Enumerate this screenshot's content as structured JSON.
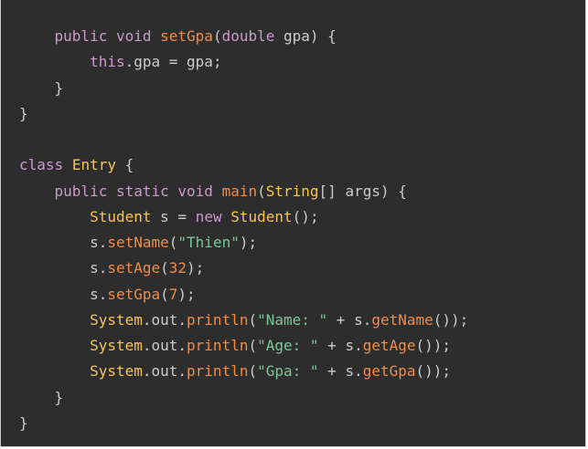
{
  "editor": {
    "theme": {
      "background": "#2d2d2d",
      "plain": "#cccccc",
      "keyword": "#cc99cd",
      "function": "#f08d49",
      "type": "#f8c555",
      "string": "#7ec699",
      "number": "#f08d49"
    },
    "lines": [
      [
        [
          "    ",
          "pl"
        ],
        [
          "public",
          "kw"
        ],
        [
          " ",
          "pl"
        ],
        [
          "void",
          "kw"
        ],
        [
          " ",
          "pl"
        ],
        [
          "setGpa",
          "fn"
        ],
        [
          "(",
          "pl"
        ],
        [
          "double",
          "kw"
        ],
        [
          " gpa) {",
          "pl"
        ]
      ],
      [
        [
          "        ",
          "pl"
        ],
        [
          "this",
          "kw"
        ],
        [
          ".gpa ",
          "pl"
        ],
        [
          "=",
          "pl"
        ],
        [
          " gpa;",
          "pl"
        ]
      ],
      [
        [
          "    }",
          "pl"
        ]
      ],
      [
        [
          "}",
          "pl"
        ]
      ],
      [
        [
          "",
          "pl"
        ]
      ],
      [
        [
          "class",
          "kw"
        ],
        [
          " ",
          "pl"
        ],
        [
          "Entry",
          "ty"
        ],
        [
          " {",
          "pl"
        ]
      ],
      [
        [
          "    ",
          "pl"
        ],
        [
          "public",
          "kw"
        ],
        [
          " ",
          "pl"
        ],
        [
          "static",
          "kw"
        ],
        [
          " ",
          "pl"
        ],
        [
          "void",
          "kw"
        ],
        [
          " ",
          "pl"
        ],
        [
          "main",
          "fn"
        ],
        [
          "(",
          "pl"
        ],
        [
          "String",
          "ty"
        ],
        [
          "[] args) {",
          "pl"
        ]
      ],
      [
        [
          "        ",
          "pl"
        ],
        [
          "Student",
          "ty"
        ],
        [
          " s ",
          "pl"
        ],
        [
          "=",
          "pl"
        ],
        [
          " ",
          "pl"
        ],
        [
          "new",
          "kw"
        ],
        [
          " ",
          "pl"
        ],
        [
          "Student",
          "ty"
        ],
        [
          "();",
          "pl"
        ]
      ],
      [
        [
          "        s.",
          "pl"
        ],
        [
          "setName",
          "fn"
        ],
        [
          "(",
          "pl"
        ],
        [
          "\"Thien\"",
          "str"
        ],
        [
          ");",
          "pl"
        ]
      ],
      [
        [
          "        s.",
          "pl"
        ],
        [
          "setAge",
          "fn"
        ],
        [
          "(",
          "pl"
        ],
        [
          "32",
          "num"
        ],
        [
          ");",
          "pl"
        ]
      ],
      [
        [
          "        s.",
          "pl"
        ],
        [
          "setGpa",
          "fn"
        ],
        [
          "(",
          "pl"
        ],
        [
          "7",
          "num"
        ],
        [
          ");",
          "pl"
        ]
      ],
      [
        [
          "        ",
          "pl"
        ],
        [
          "System",
          "ty"
        ],
        [
          ".out.",
          "pl"
        ],
        [
          "println",
          "fn"
        ],
        [
          "(",
          "pl"
        ],
        [
          "\"Name: \"",
          "str"
        ],
        [
          " + s.",
          "pl"
        ],
        [
          "getName",
          "fn"
        ],
        [
          "());",
          "pl"
        ]
      ],
      [
        [
          "        ",
          "pl"
        ],
        [
          "System",
          "ty"
        ],
        [
          ".out.",
          "pl"
        ],
        [
          "println",
          "fn"
        ],
        [
          "(",
          "pl"
        ],
        [
          "\"Age: \"",
          "str"
        ],
        [
          " + s.",
          "pl"
        ],
        [
          "getAge",
          "fn"
        ],
        [
          "());",
          "pl"
        ]
      ],
      [
        [
          "        ",
          "pl"
        ],
        [
          "System",
          "ty"
        ],
        [
          ".out.",
          "pl"
        ],
        [
          "println",
          "fn"
        ],
        [
          "(",
          "pl"
        ],
        [
          "\"Gpa: \"",
          "str"
        ],
        [
          " + s.",
          "pl"
        ],
        [
          "getGpa",
          "fn"
        ],
        [
          "());",
          "pl"
        ]
      ],
      [
        [
          "    }",
          "pl"
        ]
      ],
      [
        [
          "}",
          "pl"
        ]
      ]
    ]
  }
}
